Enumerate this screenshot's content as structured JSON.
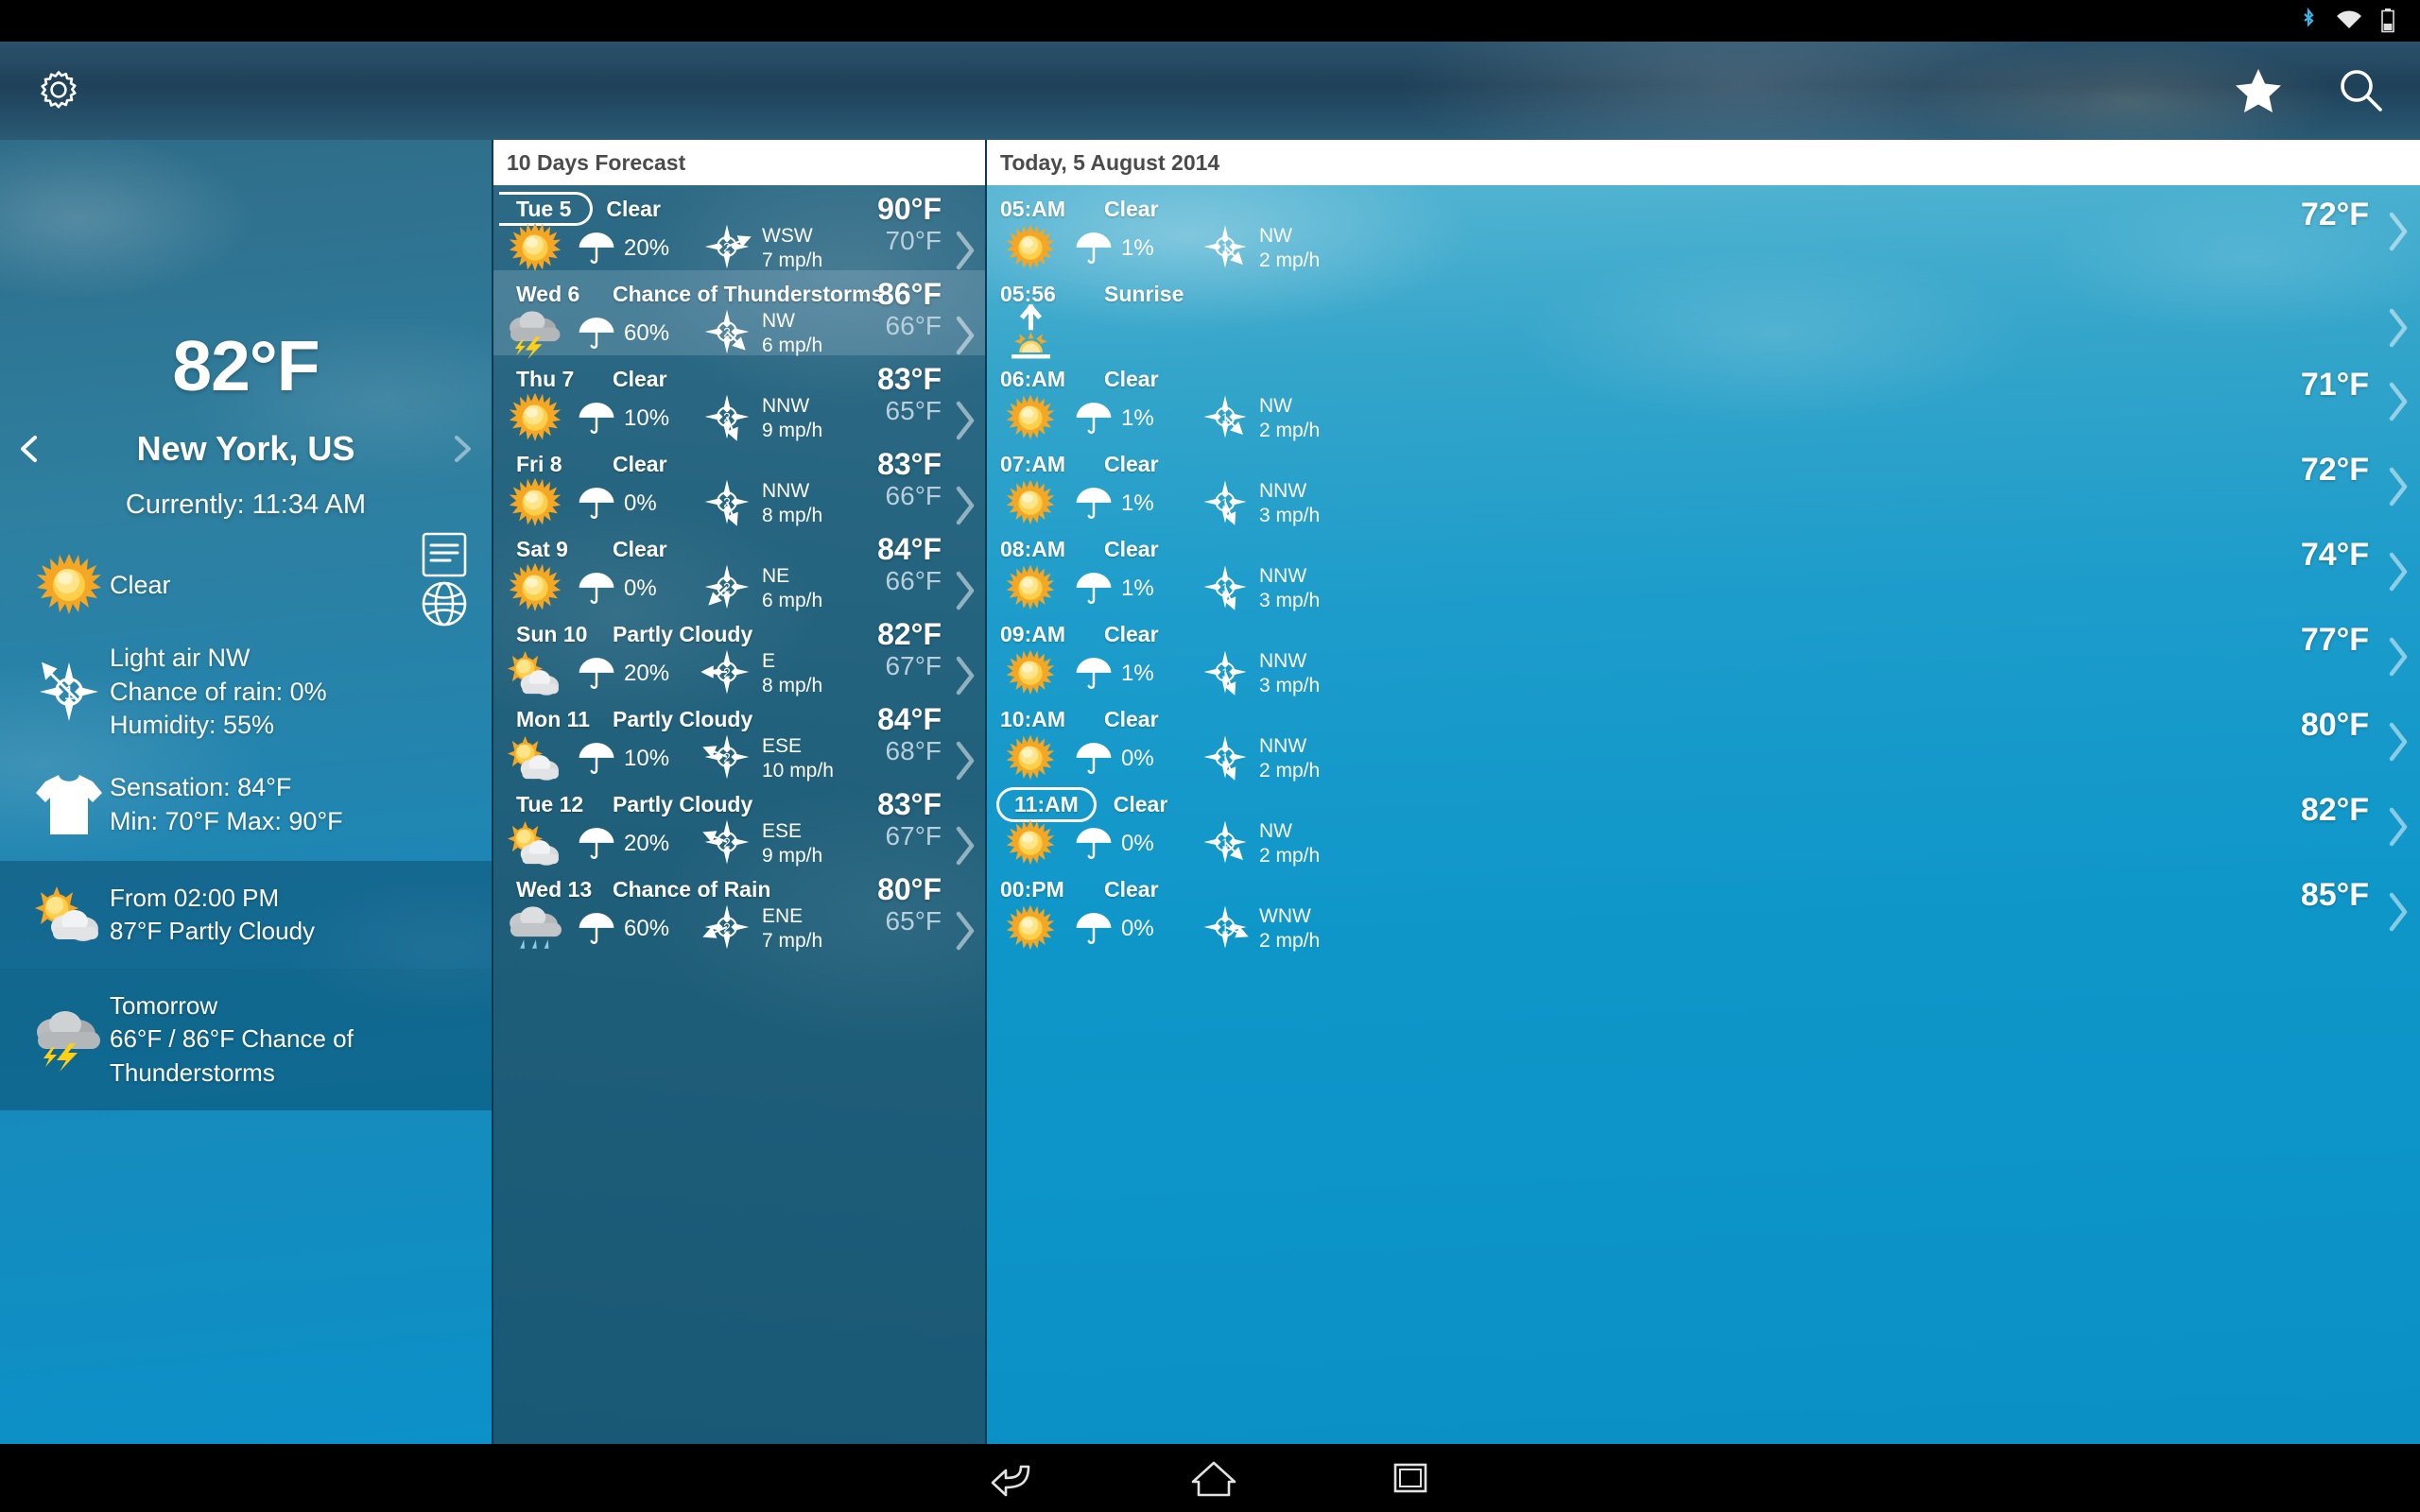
{
  "statusbar": {
    "icons": [
      "bluetooth-icon",
      "wifi-icon",
      "battery-icon"
    ]
  },
  "appbar": {
    "settings_icon": "gear-icon",
    "favorite_icon": "star-icon",
    "search_icon": "search-icon"
  },
  "current": {
    "temperature": "82°F",
    "city": "New York, US",
    "time_label": "Currently: 11:34 AM",
    "condition": "Clear",
    "condition_icon": "sun-icon",
    "wind_icon": "compass-icon",
    "wind_force": "1",
    "wind_line1": "Light air NW",
    "wind_line2": "Chance of rain: 0%",
    "wind_line3": "Humidity: 55%",
    "clothing_icon": "tshirt-icon",
    "sensation_line1": "Sensation: 84°F",
    "sensation_line2": "Min: 70°F Max: 90°F",
    "list_icon": "list-icon",
    "globe_icon": "globe-icon",
    "prev_icon": "chevron-left-icon",
    "next_icon": "chevron-right-icon",
    "cards": [
      {
        "icon": "partly-cloudy-icon",
        "line1": "From 02:00 PM",
        "line2": "87°F Partly Cloudy",
        "highlight": true
      },
      {
        "icon": "thunderstorm-icon",
        "line1": "Tomorrow",
        "line2": "66°F / 86°F Chance of Thunderstorms",
        "highlight": false
      }
    ]
  },
  "forecast": {
    "title": "10 Days Forecast",
    "days": [
      {
        "day": "Tue 5",
        "selected": true,
        "condition": "Clear",
        "icon": "sun-icon",
        "rain": "20%",
        "wind_force": "2",
        "wind_dir": "WSW",
        "wind_speed": "7 mp/h",
        "high": "90°F",
        "low": "70°F",
        "highlight": false
      },
      {
        "day": "Wed 6",
        "selected": false,
        "condition": "Chance of Thunderstorms",
        "icon": "thunderstorm-icon",
        "rain": "60%",
        "wind_force": "2",
        "wind_dir": "NW",
        "wind_speed": "6 mp/h",
        "high": "86°F",
        "low": "66°F",
        "highlight": true
      },
      {
        "day": "Thu 7",
        "selected": false,
        "condition": "Clear",
        "icon": "sun-icon",
        "rain": "10%",
        "wind_force": "2",
        "wind_dir": "NNW",
        "wind_speed": "9 mp/h",
        "high": "83°F",
        "low": "65°F",
        "highlight": false
      },
      {
        "day": "Fri 8",
        "selected": false,
        "condition": "Clear",
        "icon": "sun-icon",
        "rain": "0%",
        "wind_force": "2",
        "wind_dir": "NNW",
        "wind_speed": "8 mp/h",
        "high": "83°F",
        "low": "66°F",
        "highlight": false
      },
      {
        "day": "Sat 9",
        "selected": false,
        "condition": "Clear",
        "icon": "sun-icon",
        "rain": "0%",
        "wind_force": "2",
        "wind_dir": "NE",
        "wind_speed": "6 mp/h",
        "high": "84°F",
        "low": "66°F",
        "highlight": false
      },
      {
        "day": "Sun 10",
        "selected": false,
        "condition": "Partly Cloudy",
        "icon": "partly-cloudy-icon",
        "rain": "20%",
        "wind_force": "2",
        "wind_dir": "E",
        "wind_speed": "8 mp/h",
        "high": "82°F",
        "low": "67°F",
        "highlight": false
      },
      {
        "day": "Mon 11",
        "selected": false,
        "condition": "Partly Cloudy",
        "icon": "partly-cloudy-icon",
        "rain": "10%",
        "wind_force": "2",
        "wind_dir": "ESE",
        "wind_speed": "10 mp/h",
        "high": "84°F",
        "low": "68°F",
        "highlight": false
      },
      {
        "day": "Tue 12",
        "selected": false,
        "condition": "Partly Cloudy",
        "icon": "partly-cloudy-icon",
        "rain": "20%",
        "wind_force": "2",
        "wind_dir": "ESE",
        "wind_speed": "9 mp/h",
        "high": "83°F",
        "low": "67°F",
        "highlight": false
      },
      {
        "day": "Wed 13",
        "selected": false,
        "condition": "Chance of Rain",
        "icon": "rain-icon",
        "rain": "60%",
        "wind_force": "2",
        "wind_dir": "ENE",
        "wind_speed": "7 mp/h",
        "high": "80°F",
        "low": "65°F",
        "highlight": false
      }
    ]
  },
  "hourly": {
    "title": "Today, 5 August 2014",
    "rows": [
      {
        "type": "hour",
        "time": "05:AM",
        "condition": "Clear",
        "icon": "sun-icon",
        "rain": "1%",
        "wind_force": "1",
        "wind_dir": "NW",
        "wind_speed": "2 mp/h",
        "temp": "72°F",
        "now": false
      },
      {
        "type": "sunrise",
        "time": "05:56",
        "condition": "Sunrise",
        "icon": "sunrise-icon"
      },
      {
        "type": "hour",
        "time": "06:AM",
        "condition": "Clear",
        "icon": "sun-icon",
        "rain": "1%",
        "wind_force": "1",
        "wind_dir": "NW",
        "wind_speed": "2 mp/h",
        "temp": "71°F",
        "now": false
      },
      {
        "type": "hour",
        "time": "07:AM",
        "condition": "Clear",
        "icon": "sun-icon",
        "rain": "1%",
        "wind_force": "1",
        "wind_dir": "NNW",
        "wind_speed": "3 mp/h",
        "temp": "72°F",
        "now": false
      },
      {
        "type": "hour",
        "time": "08:AM",
        "condition": "Clear",
        "icon": "sun-icon",
        "rain": "1%",
        "wind_force": "1",
        "wind_dir": "NNW",
        "wind_speed": "3 mp/h",
        "temp": "74°F",
        "now": false
      },
      {
        "type": "hour",
        "time": "09:AM",
        "condition": "Clear",
        "icon": "sun-icon",
        "rain": "1%",
        "wind_force": "1",
        "wind_dir": "NNW",
        "wind_speed": "3 mp/h",
        "temp": "77°F",
        "now": false
      },
      {
        "type": "hour",
        "time": "10:AM",
        "condition": "Clear",
        "icon": "sun-icon",
        "rain": "0%",
        "wind_force": "1",
        "wind_dir": "NNW",
        "wind_speed": "2 mp/h",
        "temp": "80°F",
        "now": false
      },
      {
        "type": "hour",
        "time": "11:AM",
        "condition": "Clear",
        "icon": "sun-icon",
        "rain": "0%",
        "wind_force": "1",
        "wind_dir": "NW",
        "wind_speed": "2 mp/h",
        "temp": "82°F",
        "now": true
      },
      {
        "type": "hour",
        "time": "00:PM",
        "condition": "Clear",
        "icon": "sun-icon",
        "rain": "0%",
        "wind_force": "1",
        "wind_dir": "WNW",
        "wind_speed": "2 mp/h",
        "temp": "85°F",
        "now": false
      }
    ]
  },
  "navbar": {
    "back_icon": "back-icon",
    "home_icon": "home-icon",
    "recents-icon": "recents-icon"
  }
}
